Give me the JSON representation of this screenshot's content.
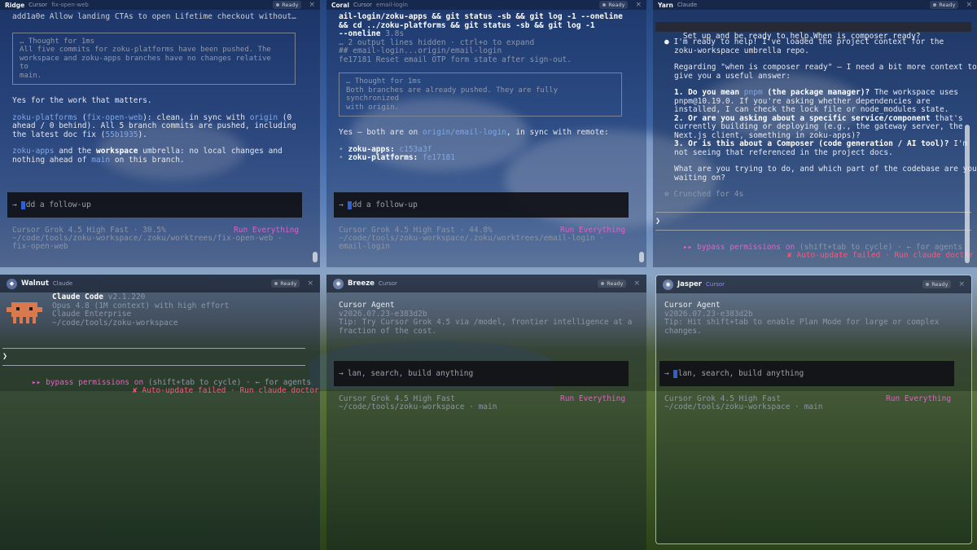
{
  "panes": {
    "ridge": {
      "name": "Ridge",
      "agent": "Cursor",
      "branch": "fix-open-web",
      "status": "Ready",
      "lines": {
        "commit": "add1a0e Allow landing CTAs to open Lifetime checkout without…",
        "thought_title": "… Thought for 1ms",
        "thought_1": "All five commits for zoku-platforms have been pushed. The",
        "thought_2": "workspace and zoku-apps branches have no changes relative",
        "thought_3": "to",
        "thought_4": "main.",
        "answer": "Yes for the work that matters.",
        "p1_name": "zoku-platforms",
        "p1_open": " (",
        "p1_branch": "fix-open-web",
        "p1_mid": "): clean, in sync with ",
        "p1_origin": "origin",
        "p1_tail": " (0",
        "p1_l2": "ahead / 0 behind). All 5 branch commits are pushed, including",
        "p1_l3a": "the latest doc fix (",
        "p1_hash": "55b1935",
        "p1_l3b": ").",
        "p2_name": "zoku-apps",
        "p2_mid": " and the ",
        "p2_ws": "workspace",
        "p2_tail": " umbrella: no local changes and",
        "p2_l2a": "nothing ahead of ",
        "p2_main": "main",
        "p2_l2b": " on this branch."
      },
      "input_placeholder": "dd a follow-up",
      "footer_model": "Cursor Grok 4.5 High Fast · 30.5%",
      "footer_run": "Run Everything",
      "footer_path_1": "~/code/tools/zoku-workspace/.zoku/worktrees/fix-open-web ·",
      "footer_path_2": "fix-open-web"
    },
    "coral": {
      "name": "Coral",
      "agent": "Cursor",
      "branch": "email-login",
      "status": "Ready",
      "lines": {
        "cmd_1": "ail-login/zoku-apps && git status -sb && git log -1 --oneline",
        "cmd_2": "&& cd ../zoku-platforms && git status -sb && git log -1",
        "cmd_3a": "--oneline",
        "cmd_3_time": " 3.8s",
        "hidden": "… 2 output lines hidden · ctrl+o to expand",
        "status": "## email-login...origin/email-login",
        "log": "fe17181 Reset email OTP form state after sign-out.",
        "thought_title": "… Thought for 1ms",
        "thought_1": "Both branches are already pushed. They are fully",
        "thought_2": "synchronized",
        "thought_3": "with origin.",
        "answer_a": "Yes — both are on ",
        "answer_branch": "origin/email-login",
        "answer_b": ", in sync with remote:",
        "b1_label": "zoku-apps:",
        "b1_hash": " c153a3f",
        "b2_label": "zoku-platforms:",
        "b2_hash": " fe17181"
      },
      "input_placeholder": "dd a follow-up",
      "footer_model": "Cursor Grok 4.5 High Fast · 44.8%",
      "footer_run": "Run Everything",
      "footer_path_1": "~/code/tools/zoku-workspace/.zoku/worktrees/email-login ·",
      "footer_path_2": "email-login"
    },
    "yarn": {
      "name": "Yarn",
      "agent": "Claude",
      "status": "Ready",
      "lines": {
        "prompt": "Set up and be ready to help.When is composer ready?",
        "r1": "I'm ready to help! I've loaded the project context for the",
        "r2": "zoku-workspace umbrella repo.",
        "r3": "Regarding \"when is composer ready\" — I need a bit more context to",
        "r4": "give you a useful answer:",
        "q1_bold": "1. Do you mean ",
        "q1_pnpm": "pnpm",
        "q1_bold2": " (the package manager)?",
        "q1_tail": " The workspace uses",
        "q1_l2": "pnpm@10.19.0. If you're asking whether dependencies are",
        "q1_l3": "installed, I can check the lock file or node_modules state.",
        "q2_bold": "2. Or are you asking about a specific service/component",
        "q2_tail": " that's",
        "q2_l2": "currently building or deploying (e.g., the gateway server, the",
        "q2_l3": "Next.js client, something in zoku-apps)?",
        "q3_bold": "3. Or is this about a Composer (code generation / AI tool)?",
        "q3_tail": " I'm",
        "q3_l2": "not seeing that referenced in the project docs.",
        "ask_1": "What are you trying to do, and which part of the codebase are you",
        "ask_2": "waiting on?",
        "crunched": "Crunched for 4s"
      },
      "perm_arrows": "▸▸",
      "perm_text": " bypass permissions on",
      "perm_hint": " (shift+tab to cycle) · ← for agents",
      "update_x": "✘",
      "update_text": " Auto-update failed · Run ",
      "update_cmd": "claude doctor"
    },
    "walnut": {
      "name": "Walnut",
      "agent": "Claude",
      "status": "Ready",
      "lines": {
        "title": "Claude Code",
        "version": " v2.1.220",
        "model": "Opus 4.8 (1M context) with high effort",
        "plan": "Claude Enterprise",
        "path": "~/code/tools/zoku-workspace"
      },
      "perm_arrows": "▸▸",
      "perm_text": " bypass permissions on",
      "perm_hint": " (shift+tab to cycle) · ← for agents",
      "update_x": "✘",
      "update_text": " Auto-update failed · Run ",
      "update_cmd": "claude doctor"
    },
    "breeze": {
      "name": "Breeze",
      "agent": "Cursor",
      "status": "Ready",
      "lines": {
        "title": "Cursor Agent",
        "version": "v2026.07.23-e383d2b",
        "tip_1": "Tip: Try Cursor Grok 4.5 via /model, frontier intelligence at a",
        "tip_2": "fraction of the cost."
      },
      "input_placeholder": "lan, search, build anything",
      "footer_model": "Cursor Grok 4.5 High Fast",
      "footer_run": "Run Everything",
      "footer_path": "~/code/tools/zoku-workspace · main"
    },
    "jasper": {
      "name": "Jasper",
      "agent": "Cursor",
      "status": "Ready",
      "lines": {
        "title": "Cursor Agent",
        "version": "v2026.07.23-e383d2b",
        "tip_1": "Tip: Hit shift+tab to enable Plan Mode for large or complex",
        "tip_2": "changes."
      },
      "input_placeholder": "lan, search, build anything",
      "footer_model": "Cursor Grok 4.5 High Fast",
      "footer_run": "Run Everything",
      "footer_path": "~/code/tools/zoku-workspace · main"
    }
  },
  "icons": {
    "prompt_arrow": "→",
    "chevron": "❯",
    "bullet": "•",
    "close": "×"
  },
  "colors": {
    "accent_blue": "#7fa7e8",
    "run_pink": "#e15fc8",
    "error_red": "#ff5577",
    "cursor_purple": "#8f8cf5"
  }
}
